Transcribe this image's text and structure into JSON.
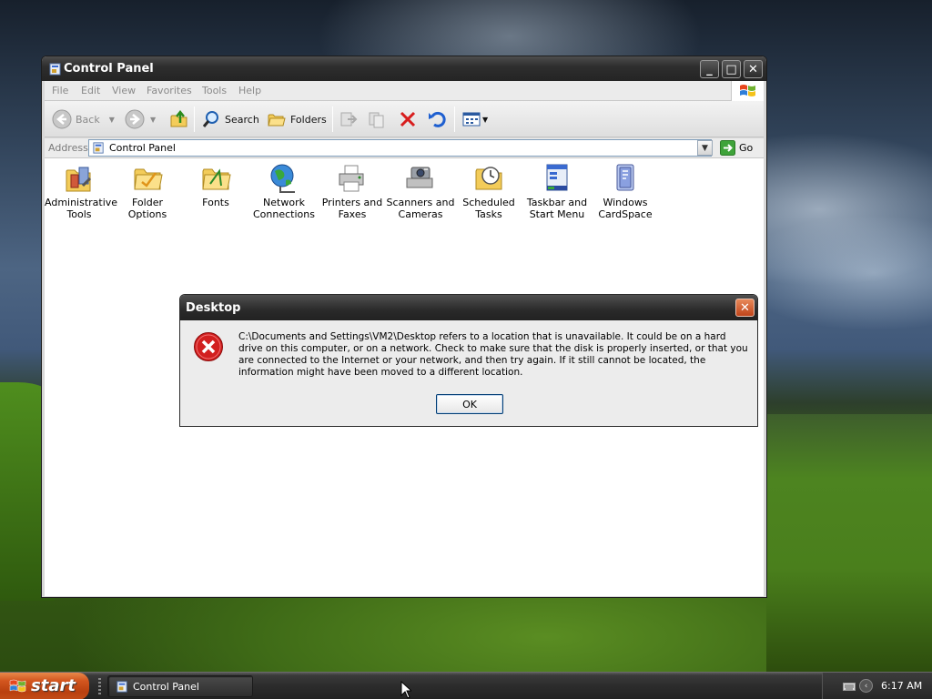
{
  "window": {
    "title": "Control Panel",
    "controls": {
      "minimize": "_",
      "maximize": "□",
      "close": "✕"
    }
  },
  "menubar": {
    "items": [
      "File",
      "Edit",
      "View",
      "Favorites",
      "Tools",
      "Help"
    ]
  },
  "toolbar": {
    "back_label": "Back",
    "search_label": "Search",
    "folders_label": "Folders"
  },
  "addressbar": {
    "label": "Address",
    "value": "Control Panel",
    "go_label": "Go"
  },
  "items": [
    {
      "line1": "Administrative",
      "line2": "Tools",
      "icon": "administrative-tools-icon"
    },
    {
      "line1": "Folder Options",
      "line2": "",
      "icon": "folder-options-icon"
    },
    {
      "line1": "Fonts",
      "line2": "",
      "icon": "fonts-icon"
    },
    {
      "line1": "Network",
      "line2": "Connections",
      "icon": "network-connections-icon"
    },
    {
      "line1": "Printers and",
      "line2": "Faxes",
      "icon": "printers-icon"
    },
    {
      "line1": "Scanners and",
      "line2": "Cameras",
      "icon": "scanners-icon"
    },
    {
      "line1": "Scheduled",
      "line2": "Tasks",
      "icon": "scheduled-tasks-icon"
    },
    {
      "line1": "Taskbar and",
      "line2": "Start Menu",
      "icon": "taskbar-icon"
    },
    {
      "line1": "Windows",
      "line2": "CardSpace",
      "icon": "cardspace-icon"
    }
  ],
  "dialog": {
    "title": "Desktop",
    "message": "C:\\Documents and Settings\\VM2\\Desktop refers to a location that is unavailable. It could be on a hard drive on this computer, or on a network. Check to make sure that the disk is properly inserted, or that you are connected to the Internet or your network, and then try again. If it still cannot be located, the information might have been moved to a different location.",
    "ok_label": "OK",
    "close_glyph": "✕"
  },
  "taskbar": {
    "start_label": "start",
    "task_label": "Control Panel",
    "clock": "6:17 AM"
  },
  "colors": {
    "titlebar": "#2e2e2e",
    "start_button": "#d3561f",
    "error_red": "#d21f1f"
  }
}
